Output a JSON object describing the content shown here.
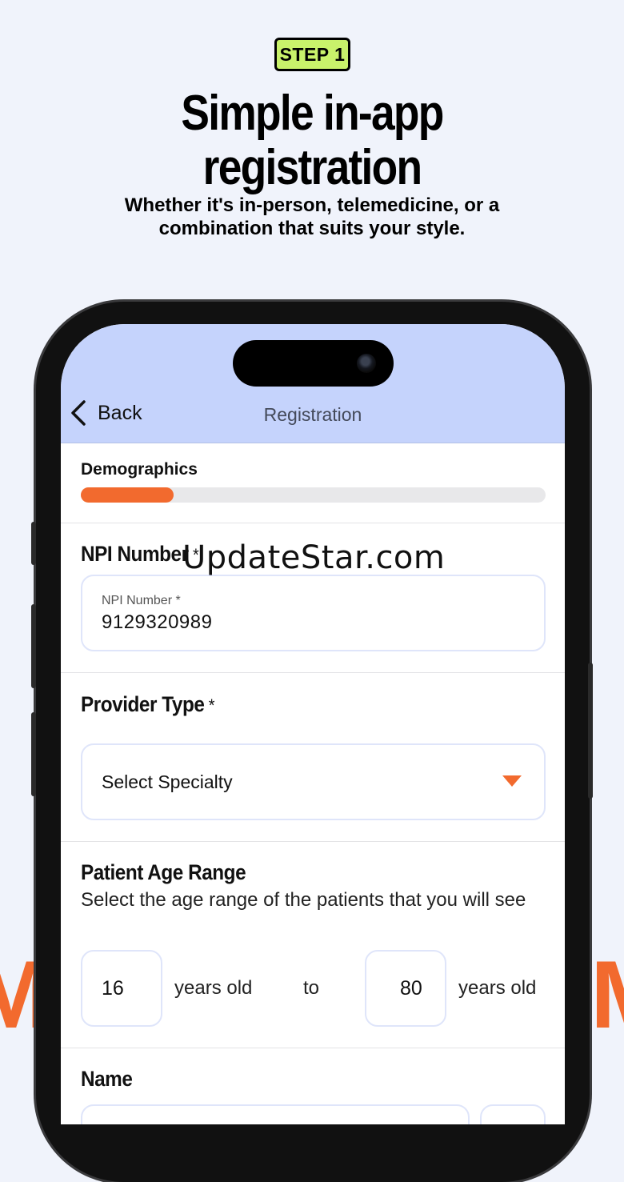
{
  "promo": {
    "step_badge": "STEP 1",
    "headline_line1": "Simple in-app",
    "headline_line2": "registration",
    "subline_line1": "Whether it's in-person, telemedicine, or a",
    "subline_line2": "combination that suits your style."
  },
  "watermark": "UpdateStar.com",
  "nav": {
    "back_label": "Back",
    "title": "Registration"
  },
  "progress": {
    "section_label": "Demographics",
    "value": 0.2
  },
  "npi": {
    "heading": "NPI Number",
    "required_mark": "*",
    "float_label": "NPI Number *",
    "value": "9129320989"
  },
  "provider_type": {
    "heading": "Provider Type",
    "required_mark": "*",
    "selected_value": "Select Specialty"
  },
  "age_range": {
    "heading": "Patient Age Range",
    "description": "Select the age range of the patients that you will see",
    "min_value": "16",
    "min_suffix": "years old",
    "connector": "to",
    "max_value": "80",
    "max_suffix": "years old"
  },
  "name": {
    "heading": "Name"
  },
  "colors": {
    "accent": "#f26a2e",
    "badge": "#c9f26b",
    "navbar": "#c5d3fc"
  }
}
